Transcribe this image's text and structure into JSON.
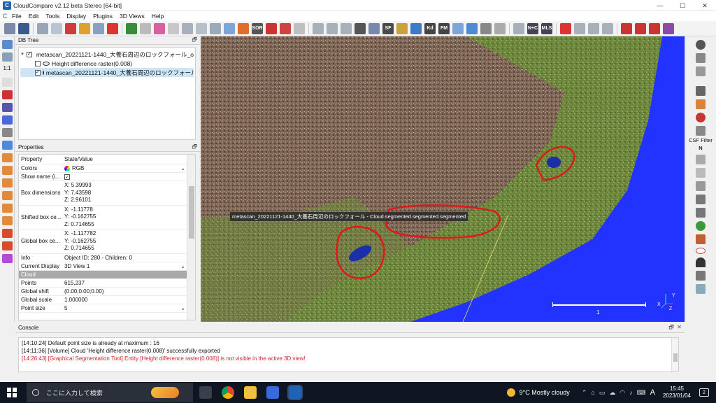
{
  "window": {
    "title": "CloudCompare v2.12 beta Stereo [64-bit]",
    "app_icon_glyph": "C",
    "controls": {
      "minimize": "—",
      "maximize": "☐",
      "close": "✕"
    }
  },
  "menu": [
    "File",
    "Edit",
    "Tools",
    "Display",
    "Plugins",
    "3D Views",
    "Help"
  ],
  "toolbar": {
    "labels": {
      "sor": "SOR",
      "sf": "SF",
      "kd": "Kd",
      "fm": "FM",
      "nc": "N+C",
      "mls": "MLS"
    }
  },
  "right_toolbar": {
    "csf_label": "CSF Filter",
    "n_label": "N"
  },
  "db_tree": {
    "title": "DB Tree",
    "pin": "🗗",
    "items": [
      {
        "label": "metascan_20221121-1440_大養石周辺のロックフォール_only...",
        "checked": "✓"
      },
      {
        "label": "Height difference raster(0.008)",
        "checked": ""
      },
      {
        "label": "metascan_20221121-1440_大養石周辺のロックフォール - ...",
        "checked": "✓"
      }
    ]
  },
  "properties": {
    "title": "Properties",
    "pin": "🗗",
    "header": {
      "property": "Property",
      "value": "State/Value"
    },
    "colors": {
      "key": "Colors",
      "value": "RGB"
    },
    "show_name": {
      "key": "Show name (i...",
      "value": "✓"
    },
    "box_dimensions": {
      "key": "Box dimensions",
      "x": "X: 5.39993",
      "y": "Y: 7.43598",
      "z": "Z: 2.96101"
    },
    "shifted_box": {
      "key": "Shifted box ce...",
      "x": "X: -1.11778",
      "y": "Y: -0.162755",
      "z": "Z: 0.714655"
    },
    "global_box": {
      "key": "Global box ce...",
      "x": "X: -1.117782",
      "y": "Y: -0.162755",
      "z": "Z: 0.714655"
    },
    "info": {
      "key": "Info",
      "value": "Object ID: 280 - Children: 0"
    },
    "current_display": {
      "key": "Current Display",
      "value": "3D View 1"
    },
    "cloud_section": "Cloud",
    "points": {
      "key": "Points",
      "value": "615,237"
    },
    "global_shift": {
      "key": "Global shift",
      "value": "(0.00;0.00;0.00)"
    },
    "global_scale": {
      "key": "Global scale",
      "value": "1.000000"
    },
    "point_size": {
      "key": "Point size",
      "value": "5"
    }
  },
  "viewport": {
    "object_label": "metascan_20221121-1440_大養石周辺のロックフォール - Cloud.segmented.segmented.segmented",
    "scale_value": "1",
    "axis_x": "X",
    "axis_y": "Y",
    "axis_z": "Z"
  },
  "console": {
    "title": "Console",
    "pin": "🗗",
    "close": "✕",
    "lines": [
      "[14:10:24] Default point size is already at maximum : 16",
      "[14:11:36] [Volume] Cloud 'Height difference raster(0.008)' successfully exported",
      "[14:26:43] [Graphical Segmentation Tool] Entity [Height difference raster(0.008)] is not visible in the active 3D view!"
    ]
  },
  "taskbar": {
    "search_placeholder": "ここに入力して検索",
    "weather": "9°C  Mostly cloudy",
    "ime": "A",
    "time": "15:45",
    "date": "2023/01/04",
    "notif_count": "2"
  }
}
